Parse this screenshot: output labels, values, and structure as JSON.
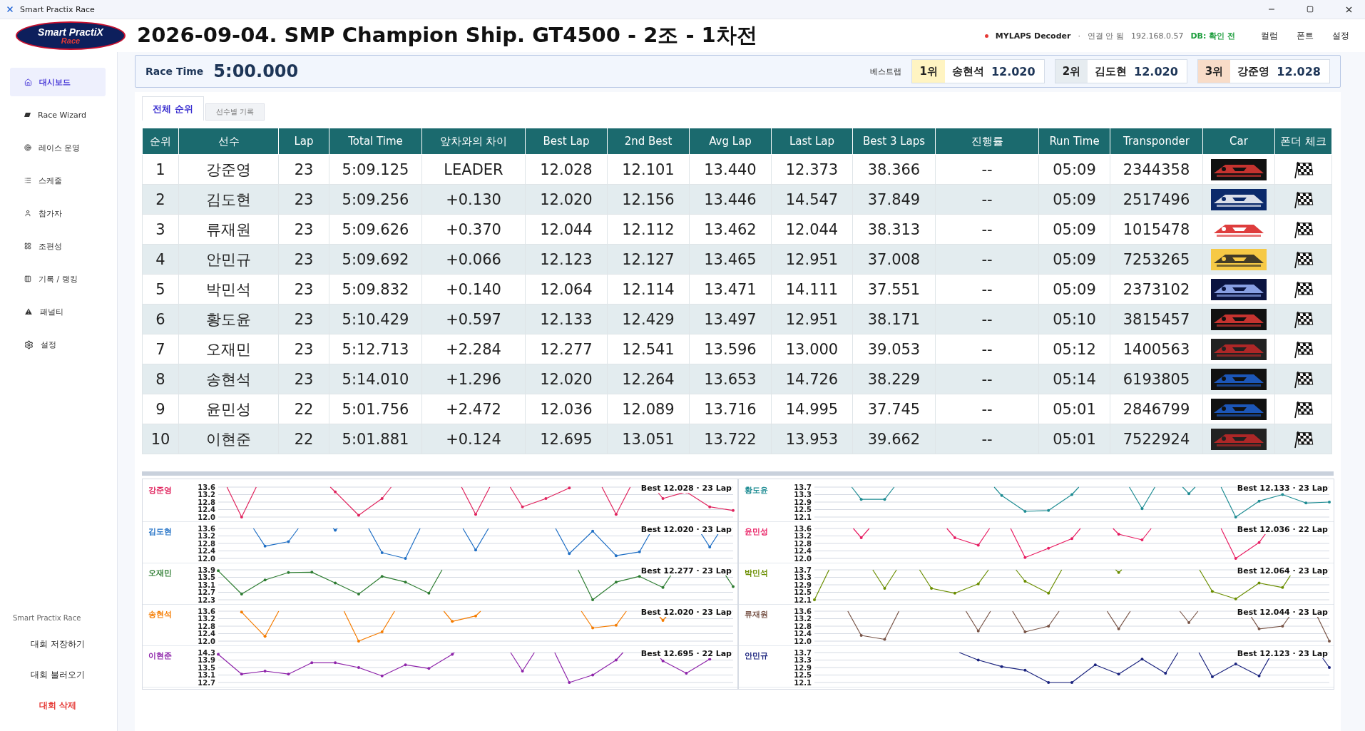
{
  "window": {
    "title": "Smart Practix Race"
  },
  "logo": {
    "line1": "Smart PractiX",
    "line2": "Race"
  },
  "race_title": "2026-09-04. SMP Champion Ship. GT4500 - 2조 - 1차전",
  "status": {
    "decoder": "MYLAPS Decoder",
    "connected": false,
    "separator": "·",
    "connection": "연결 안 됨",
    "ip": "192.168.0.57",
    "db": "DB: 확인 전"
  },
  "header_buttons": [
    "컬럼",
    "폰트",
    "설정"
  ],
  "sidebar": {
    "items": [
      {
        "label": "대시보드",
        "selected": true
      },
      {
        "label": "Race Wizard",
        "selected": false
      },
      {
        "label": "레이스 운영",
        "selected": false
      },
      {
        "label": "스케줄",
        "selected": false
      },
      {
        "label": "참가자",
        "selected": false
      },
      {
        "label": "조편성",
        "selected": false
      },
      {
        "label": "기록 / 랭킹",
        "selected": false
      },
      {
        "label": "패널티",
        "selected": false
      },
      {
        "label": "설정",
        "selected": false
      }
    ],
    "footer_title": "Smart Practix Race",
    "actions": [
      {
        "label": "대회 저장하기",
        "kind": "normal"
      },
      {
        "label": "대회 불러오기",
        "kind": "normal"
      },
      {
        "label": "대회 삭제",
        "kind": "danger"
      }
    ]
  },
  "race_bar": {
    "label": "Race Time",
    "time": "5:00.000",
    "best_label": "베스트랩",
    "podium": [
      {
        "rank": "1위",
        "name": "송현석",
        "time": "12.020",
        "color": "#fff4c2"
      },
      {
        "rank": "2위",
        "name": "김도현",
        "time": "12.020",
        "color": "#e6ecf0"
      },
      {
        "rank": "3위",
        "name": "강준영",
        "time": "12.028",
        "color": "#f8dcc8"
      }
    ]
  },
  "tabs": [
    {
      "label": "전체 순위",
      "selected": true
    },
    {
      "label": "선수별 기록",
      "selected": false
    }
  ],
  "table": {
    "columns": [
      "순위",
      "선수",
      "Lap",
      "Total Time",
      "앞차와의 차이",
      "Best Lap",
      "2nd Best",
      "Avg Lap",
      "Last Lap",
      "Best 3 Laps",
      "진행률",
      "Run Time",
      "Transponder",
      "Car",
      "폰더 체크"
    ],
    "rows": [
      {
        "cells": [
          "1",
          "강준영",
          "23",
          "5:09.125",
          "LEADER",
          "12.028",
          "12.101",
          "13.440",
          "12.373",
          "38.366",
          "--",
          "05:09",
          "2344358"
        ]
      },
      {
        "cells": [
          "2",
          "김도현",
          "23",
          "5:09.256",
          "+0.130",
          "12.020",
          "12.156",
          "13.446",
          "14.547",
          "37.849",
          "--",
          "05:09",
          "2517496"
        ]
      },
      {
        "cells": [
          "3",
          "류재원",
          "23",
          "5:09.626",
          "+0.370",
          "12.044",
          "12.112",
          "13.462",
          "12.044",
          "38.313",
          "--",
          "05:09",
          "1015478"
        ]
      },
      {
        "cells": [
          "4",
          "안민규",
          "23",
          "5:09.692",
          "+0.066",
          "12.123",
          "12.127",
          "13.465",
          "12.951",
          "37.008",
          "--",
          "05:09",
          "7253265"
        ]
      },
      {
        "cells": [
          "5",
          "박민석",
          "23",
          "5:09.832",
          "+0.140",
          "12.064",
          "12.114",
          "13.471",
          "14.111",
          "37.551",
          "--",
          "05:09",
          "2373102"
        ]
      },
      {
        "cells": [
          "6",
          "황도윤",
          "23",
          "5:10.429",
          "+0.597",
          "12.133",
          "12.429",
          "13.497",
          "12.951",
          "38.171",
          "--",
          "05:10",
          "3815457"
        ]
      },
      {
        "cells": [
          "7",
          "오재민",
          "23",
          "5:12.713",
          "+2.284",
          "12.277",
          "12.541",
          "13.596",
          "13.000",
          "39.053",
          "--",
          "05:12",
          "1400563"
        ]
      },
      {
        "cells": [
          "8",
          "송현석",
          "23",
          "5:14.010",
          "+1.296",
          "12.020",
          "12.264",
          "13.653",
          "14.726",
          "38.229",
          "--",
          "05:14",
          "6193805"
        ]
      },
      {
        "cells": [
          "9",
          "윤민성",
          "22",
          "5:01.756",
          "+2.472",
          "12.036",
          "12.089",
          "13.716",
          "14.995",
          "37.745",
          "--",
          "05:01",
          "2846799"
        ]
      },
      {
        "cells": [
          "10",
          "이현준",
          "22",
          "5:01.881",
          "+0.124",
          "12.695",
          "13.051",
          "13.722",
          "13.953",
          "39.662",
          "--",
          "05:01",
          "7522924"
        ]
      }
    ]
  },
  "charts": [
    {
      "driver": "강준영",
      "color": "#e0245e",
      "best": "Best 12.028 · 23 Lap",
      "y_labels": [
        "13.6",
        "13.2",
        "12.8",
        "12.4",
        "12.0"
      ]
    },
    {
      "driver": "황도윤",
      "color": "#1e8c93",
      "best": "Best 12.133 · 23 Lap",
      "y_labels": [
        "13.7",
        "13.3",
        "12.9",
        "12.5",
        "12.1"
      ]
    },
    {
      "driver": "김도현",
      "color": "#1f6fc5",
      "best": "Best 12.020 · 23 Lap",
      "y_labels": [
        "13.6",
        "13.2",
        "12.8",
        "12.4",
        "12.0"
      ]
    },
    {
      "driver": "윤민성",
      "color": "#e91e63",
      "best": "Best 12.036 · 22 Lap",
      "y_labels": [
        "13.6",
        "13.2",
        "12.8",
        "12.4",
        "12.0"
      ]
    },
    {
      "driver": "오재민",
      "color": "#2e7d32",
      "best": "Best 12.277 · 23 Lap",
      "y_labels": [
        "13.9",
        "13.5",
        "13.1",
        "12.7",
        "12.3"
      ]
    },
    {
      "driver": "박민석",
      "color": "#6b8e00",
      "best": "Best 12.064 · 23 Lap",
      "y_labels": [
        "13.7",
        "13.3",
        "12.9",
        "12.5",
        "12.1"
      ]
    },
    {
      "driver": "송현석",
      "color": "#f57c00",
      "best": "Best 12.020 · 23 Lap",
      "y_labels": [
        "13.6",
        "13.2",
        "12.8",
        "12.4",
        "12.0"
      ]
    },
    {
      "driver": "류재원",
      "color": "#795548",
      "best": "Best 12.044 · 23 Lap",
      "y_labels": [
        "13.6",
        "13.2",
        "12.8",
        "12.4",
        "12.0"
      ]
    },
    {
      "driver": "이현준",
      "color": "#8e24aa",
      "best": "Best 12.695 · 22 Lap",
      "y_labels": [
        "14.3",
        "13.9",
        "13.5",
        "13.1",
        "12.7"
      ]
    },
    {
      "driver": "안민규",
      "color": "#1a237e",
      "best": "Best 12.123 · 23 Lap",
      "y_labels": [
        "13.7",
        "13.3",
        "12.9",
        "12.5",
        "12.1"
      ]
    }
  ]
}
